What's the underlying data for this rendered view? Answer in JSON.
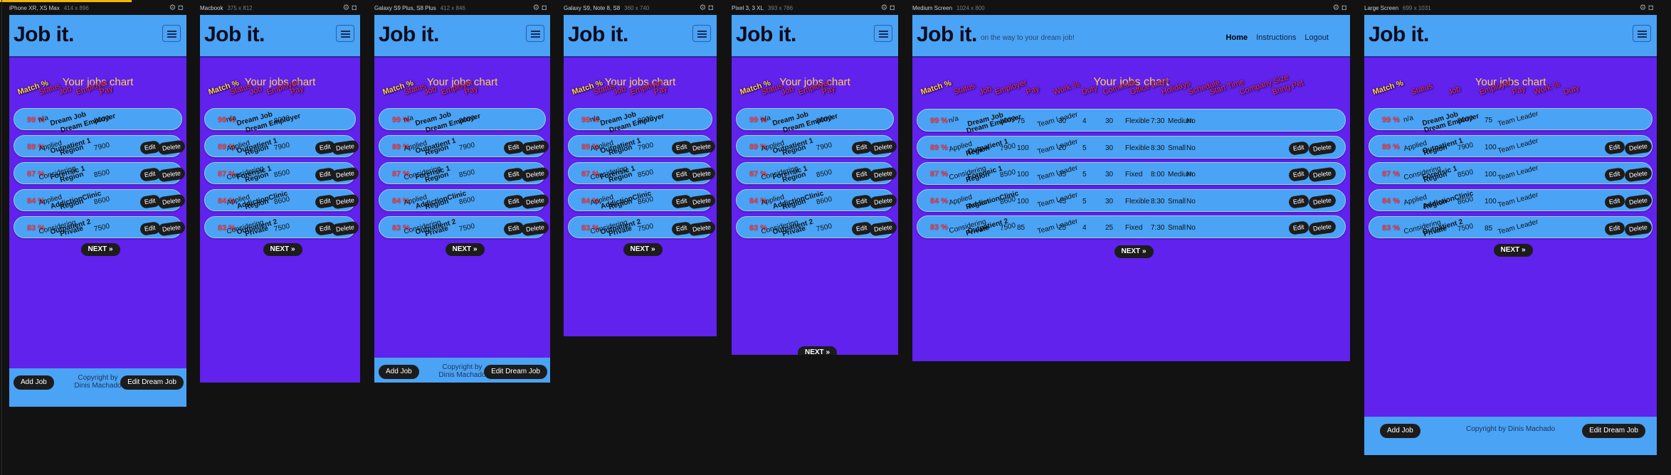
{
  "brand": "Job it.",
  "tagline": "on the way to your dream job!",
  "nav": {
    "home": "Home",
    "instructions": "Instructions",
    "logout": "Logout"
  },
  "chart_title": "Your jobs chart",
  "headers": {
    "match": "Match %",
    "status": "Status",
    "job": "Job",
    "employer": "Employer",
    "pay": "Pay",
    "work": "Work %",
    "duty": "Duty",
    "commute": "Commute",
    "office_days": "Office Days",
    "holidays": "Holidays",
    "schedule": "Schedule",
    "start_time": "Start Time",
    "company_size": "Company Size",
    "bring_pet": "Bring Pet"
  },
  "buttons": {
    "edit": "Edit",
    "delete": "Delete",
    "next": "NEXT »",
    "add_job": "Add Job",
    "edit_dream_job": "Edit Dream Job"
  },
  "copyright_line1": "Copyright by",
  "copyright_line2": "Dinis Machado",
  "copyright_full": "Copyright by Dinis Machado",
  "devices": [
    {
      "name": "iPhone XR, XS Max",
      "dims": "414 x 896"
    },
    {
      "name": "Macbook",
      "dims": "375 x 812"
    },
    {
      "name": "Galaxy S9 Plus, S8 Plus",
      "dims": "412 x 846"
    },
    {
      "name": "Galaxy S9, Note 8, S8",
      "dims": "360 x 740"
    },
    {
      "name": "Pixel 3, 3 XL",
      "dims": "393 x 786"
    },
    {
      "name": "Medium Screen",
      "dims": "1024 x 800"
    },
    {
      "name": "Large Screen",
      "dims": "699 x 1031"
    }
  ],
  "jobs": [
    {
      "match": "99 %",
      "status": "n/a",
      "job": "Dream Job",
      "employer": "Dream Employer",
      "pay": "8000",
      "work": "75",
      "duty": "Team Leader",
      "commute": "30",
      "office_days": "4",
      "holidays": "30",
      "schedule": "Flexible",
      "start_time": "7:30",
      "company_size": "Medium",
      "bring_pet": "No",
      "actions": false
    },
    {
      "match": "89 %",
      "status": "Applied",
      "job": "Outpatient 1",
      "employer": "Region",
      "pay": "7900",
      "work": "100",
      "duty": "Team Leader",
      "commute": "20",
      "office_days": "5",
      "holidays": "30",
      "schedule": "Flexible",
      "start_time": "8:30",
      "company_size": "Small",
      "bring_pet": "No",
      "actions": true
    },
    {
      "match": "87 %",
      "status": "Considering",
      "job": "Forensic 1",
      "employer": "Region",
      "pay": "8500",
      "work": "100",
      "duty": "Team Leader",
      "commute": "35",
      "office_days": "5",
      "holidays": "30",
      "schedule": "Fixed",
      "start_time": "8:00",
      "company_size": "Medium",
      "bring_pet": "No",
      "actions": true
    },
    {
      "match": "84 %",
      "status": "Applied",
      "job": "AddictionClinic",
      "employer": "Region",
      "pay": "8600",
      "work": "100",
      "duty": "Team Leader",
      "commute": "45",
      "office_days": "5",
      "holidays": "30",
      "schedule": "Flexible",
      "start_time": "8:30",
      "company_size": "Small",
      "bring_pet": "No",
      "actions": true
    },
    {
      "match": "83 %",
      "status": "Considering",
      "job": "Outpatient 2",
      "employer": "Private",
      "pay": "7500",
      "work": "85",
      "duty": "Team Leader",
      "commute": "25",
      "office_days": "4",
      "holidays": "25",
      "schedule": "Fixed",
      "start_time": "7:30",
      "company_size": "Small",
      "bring_pet": "No",
      "actions": true
    }
  ]
}
